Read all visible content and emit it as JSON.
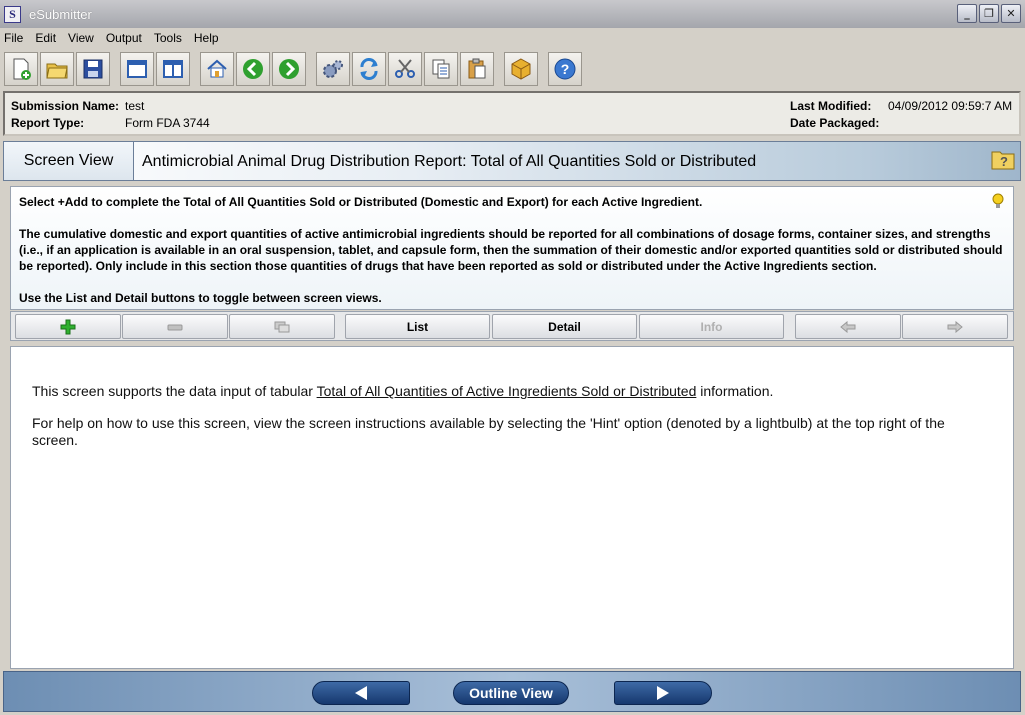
{
  "window": {
    "title": "eSubmitter",
    "icon_letter": "S"
  },
  "menu": [
    {
      "label": "File"
    },
    {
      "label": "Edit"
    },
    {
      "label": "View"
    },
    {
      "label": "Output"
    },
    {
      "label": "Tools"
    },
    {
      "label": "Help"
    }
  ],
  "toolbar_icons": [
    "new-document-icon",
    "open-folder-icon",
    "save-icon",
    "window-icon",
    "split-view-icon",
    "home-icon",
    "back-arrow-icon",
    "forward-arrow-icon",
    "gears-icon",
    "refresh-icon",
    "cut-icon",
    "copy-icon",
    "paste-icon",
    "package-icon",
    "help-icon"
  ],
  "submission": {
    "name_label": "Submission Name:",
    "name_value": "test",
    "type_label": "Report Type:",
    "type_value": "Form FDA 3744",
    "modified_label": "Last Modified:",
    "modified_value": "04/09/2012 09:59:7 AM",
    "packaged_label": "Date Packaged:",
    "packaged_value": ""
  },
  "screen_view": {
    "label": "Screen View",
    "title": "Antimicrobial Animal Drug Distribution Report: Total of All Quantities Sold or Distributed"
  },
  "instructions": {
    "p1": "Select +Add to complete the Total of All Quantities Sold or Distributed (Domestic and Export) for each Active Ingredient.",
    "p2": "The cumulative domestic and export quantities of active antimicrobial ingredients should be reported for all combinations of dosage forms, container sizes, and strengths (i.e., if an application is available in an oral suspension, tablet, and capsule form, then the summation of their domestic and/or exported quantities sold or distributed should be reported). Only include in this section those quantities of drugs that have been reported as sold or distributed under the Active Ingredients section.",
    "p3": "Use the List and Detail buttons to toggle between screen views."
  },
  "actions": {
    "list": "List",
    "detail": "Detail",
    "info": "Info"
  },
  "content": {
    "line1_pre": "This screen supports the data input of tabular ",
    "line1_link": "Total of All Quantities of Active Ingredients Sold or Distributed",
    "line1_post": " information.",
    "line2": "For help on how to use this screen, view the screen instructions available by selecting the 'Hint' option (denoted by a lightbulb) at the top right of the screen."
  },
  "nav": {
    "outline": "Outline View"
  },
  "colors": {
    "accent": "#16386e",
    "title_bar": "#a4a6ac",
    "add_green": "#2fb02f"
  }
}
